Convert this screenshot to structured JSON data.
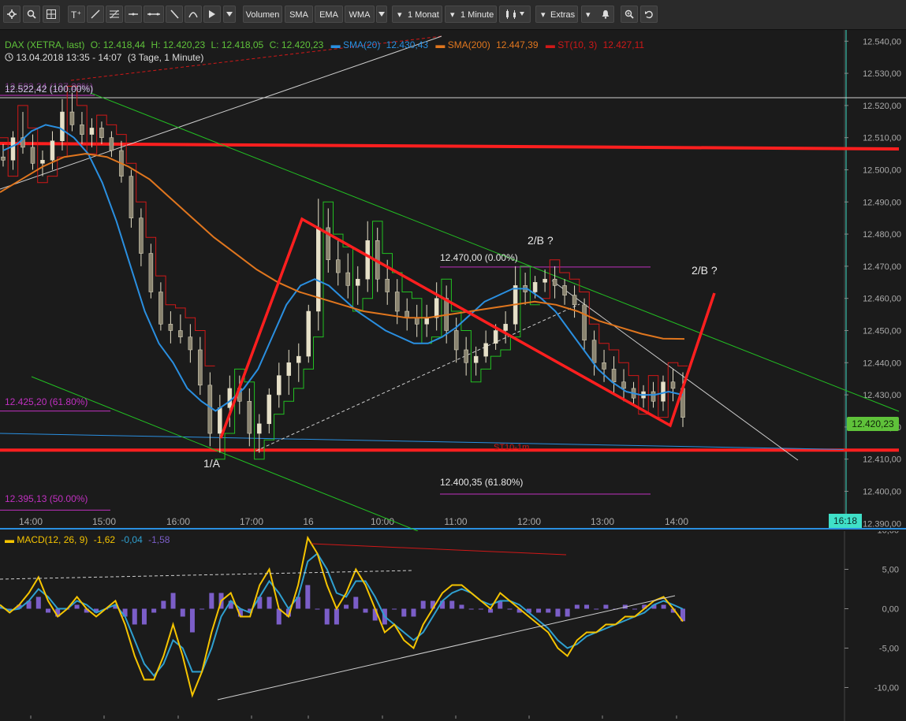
{
  "toolbar": {
    "buttons": [
      {
        "name": "settings-icon",
        "label": ""
      },
      {
        "name": "search-icon",
        "label": ""
      },
      {
        "name": "grid-icon",
        "label": ""
      },
      {
        "name": "text-tool-icon",
        "label": ""
      },
      {
        "name": "line-tool-icon",
        "label": ""
      },
      {
        "name": "fibonacci-tool-icon",
        "label": ""
      },
      {
        "name": "horizontal-line-icon",
        "label": ""
      },
      {
        "name": "channel-tool-icon",
        "label": ""
      },
      {
        "name": "pencil-icon",
        "label": ""
      },
      {
        "name": "curve-tool-icon",
        "label": ""
      },
      {
        "name": "cursor-icon",
        "label": ""
      },
      {
        "name": "dropdown-1",
        "label": ""
      },
      {
        "name": "volumen",
        "label": "Volumen"
      },
      {
        "name": "sma",
        "label": "SMA"
      },
      {
        "name": "ema",
        "label": "EMA"
      },
      {
        "name": "wma",
        "label": "WMA"
      },
      {
        "name": "period",
        "label": "1 Monat"
      },
      {
        "name": "interval",
        "label": "1 Minute"
      },
      {
        "name": "candles",
        "label": ""
      },
      {
        "name": "extras",
        "label": "Extras"
      },
      {
        "name": "alarm",
        "label": ""
      },
      {
        "name": "zoom",
        "label": ""
      },
      {
        "name": "reset",
        "label": ""
      }
    ]
  },
  "header": {
    "instrument": "DAX (XETRA, last)",
    "open": "O: 12.418,44",
    "high": "H: 12.420,23",
    "low": "L: 12.418,05",
    "close": "C: 12.420,23",
    "sma20_label": "SMA(20)",
    "sma20_value": "12.430,43",
    "sma200_label": "SMA(200)",
    "sma200_value": "12.447,39",
    "st_label": "ST(10, 3)",
    "st_value": "12.427,11",
    "date_range": "13.04.2018 13:35 - 14:07",
    "span": "(3 Tage, 1 Minute)"
  },
  "annotations": {
    "fib_100": "12.522,42 (100.00%)",
    "fib_127": "12.583,24 (127.20%)",
    "fib_618_left": "12.425,20 (61.80%)",
    "fib_50": "12.395,13 (50.00%)",
    "fib_0": "12.470,00 (0.00%)",
    "fib_618_right": "12.400,35 (61.80%)",
    "wave_1a": "1/A",
    "wave_2b_1": "2/B ?",
    "wave_2b_2": "2/B ?",
    "st_marker": "ST10-1m"
  },
  "price_axis": {
    "current_price": "12.420,23",
    "current_time": "16:18"
  },
  "macd_header": {
    "label": "MACD(12, 26, 9)",
    "v1": "-1,62",
    "v2": "-0,04",
    "v3": "-1,58"
  },
  "colors": {
    "background": "#1b1b1b",
    "candle": "#e6e0c8",
    "sma20": "#2a8fe0",
    "sma200": "#e0761e",
    "supertrend_red": "#d01818",
    "supertrend_green": "#22c022",
    "trend_red": "#ff1f1f",
    "fib_magenta": "#c030c0",
    "macd_yellow": "#f5c400",
    "macd_blue": "#2fa0d0",
    "macd_hist": "#7b5ec8",
    "price_tag": "#5fc23a"
  },
  "chart_data": [
    {
      "type": "candlestick",
      "title": "DAX (XETRA, last)",
      "interval": "1 Minute",
      "x_tick_labels": [
        "14:00",
        "15:00",
        "16:00",
        "17:00",
        "16",
        "10:00",
        "11:00",
        "12:00",
        "13:00",
        "14:00"
      ],
      "y_tick_labels": [
        "12.540,00",
        "12.530,00",
        "12.520,00",
        "12.510,00",
        "12.500,00",
        "12.490,00",
        "12.480,00",
        "12.470,00",
        "12.460,00",
        "12.450,00",
        "12.440,00",
        "12.430,00",
        "12.420,00",
        "12.410,00",
        "12.400,00",
        "12.390,00"
      ],
      "ylim": [
        12390,
        12543
      ],
      "grid": false,
      "horizontal_levels": [
        12522.42,
        12508.5,
        12413
      ],
      "series": [
        {
          "name": "DAX",
          "values": [
            [
              12504,
              12508,
              12501,
              12503
            ],
            [
              12503,
              12512,
              12500,
              12510
            ],
            [
              12510,
              12518,
              12505,
              12507
            ],
            [
              12507,
              12511,
              12500,
              12502
            ],
            [
              12502,
              12506,
              12498,
              12503
            ],
            [
              12503,
              12512,
              12500,
              12509
            ],
            [
              12509,
              12522,
              12506,
              12518
            ],
            [
              12518,
              12524,
              12512,
              12514
            ],
            [
              12514,
              12518,
              12508,
              12511
            ],
            [
              12511,
              12516,
              12507,
              12513
            ],
            [
              12513,
              12515,
              12508,
              12510
            ],
            [
              12510,
              12512,
              12504,
              12506
            ],
            [
              12506,
              12509,
              12496,
              12498
            ],
            [
              12498,
              12500,
              12482,
              12485
            ],
            [
              12485,
              12488,
              12470,
              12474
            ],
            [
              12474,
              12477,
              12460,
              12462
            ],
            [
              12462,
              12465,
              12450,
              12452
            ],
            [
              12452,
              12456,
              12446,
              12450
            ],
            [
              12450,
              12455,
              12446,
              12448
            ],
            [
              12448,
              12452,
              12440,
              12444
            ],
            [
              12444,
              12448,
              12430,
              12433
            ],
            [
              12433,
              12437,
              12414,
              12418
            ],
            [
              12418,
              12430,
              12412,
              12426
            ],
            [
              12426,
              12436,
              12420,
              12432
            ],
            [
              12432,
              12436,
              12424,
              12428
            ],
            [
              12428,
              12432,
              12414,
              12418
            ],
            [
              12418,
              12424,
              12412,
              12421
            ],
            [
              12421,
              12432,
              12418,
              12430
            ],
            [
              12430,
              12440,
              12426,
              12436
            ],
            [
              12436,
              12444,
              12430,
              12440
            ],
            [
              12440,
              12446,
              12434,
              12442
            ],
            [
              12442,
              12458,
              12440,
              12456
            ],
            [
              12456,
              12491,
              12450,
              12482
            ],
            [
              12482,
              12488,
              12468,
              12472
            ],
            [
              12472,
              12478,
              12464,
              12468
            ],
            [
              12468,
              12474,
              12460,
              12464
            ],
            [
              12464,
              12470,
              12458,
              12466
            ],
            [
              12466,
              12484,
              12462,
              12478
            ],
            [
              12478,
              12482,
              12462,
              12466
            ],
            [
              12466,
              12472,
              12458,
              12462
            ],
            [
              12462,
              12466,
              12452,
              12456
            ],
            [
              12456,
              12460,
              12450,
              12454
            ],
            [
              12454,
              12458,
              12448,
              12452
            ],
            [
              12452,
              12458,
              12448,
              12454
            ],
            [
              12454,
              12465,
              12450,
              12460
            ],
            [
              12460,
              12464,
              12446,
              12450
            ],
            [
              12450,
              12454,
              12440,
              12444
            ],
            [
              12444,
              12448,
              12436,
              12440
            ],
            [
              12440,
              12445,
              12436,
              12442
            ],
            [
              12442,
              12450,
              12440,
              12446
            ],
            [
              12446,
              12452,
              12444,
              12450
            ],
            [
              12450,
              12456,
              12446,
              12452
            ],
            [
              12452,
              12470,
              12450,
              12464
            ],
            [
              12464,
              12468,
              12458,
              12462
            ],
            [
              12462,
              12467,
              12460,
              12465
            ],
            [
              12465,
              12469,
              12462,
              12466
            ],
            [
              12466,
              12470,
              12460,
              12464
            ],
            [
              12464,
              12466,
              12458,
              12461
            ],
            [
              12461,
              12464,
              12454,
              12458
            ],
            [
              12458,
              12460,
              12444,
              12447
            ],
            [
              12447,
              12450,
              12436,
              12440
            ],
            [
              12440,
              12444,
              12434,
              12438
            ],
            [
              12438,
              12442,
              12430,
              12434
            ],
            [
              12434,
              12438,
              12428,
              12432
            ],
            [
              12432,
              12434,
              12427,
              12429
            ],
            [
              12429,
              12433,
              12426,
              12431
            ],
            [
              12431,
              12434,
              12426,
              12428
            ],
            [
              12428,
              12436,
              12425,
              12434
            ],
            [
              12434,
              12438,
              12428,
              12432
            ],
            [
              12432,
              12437,
              12420,
              12423
            ]
          ]
        },
        {
          "name": "SMA(20)",
          "values": [
            12506,
            12508,
            12512,
            12514,
            12513,
            12510,
            12505,
            12496,
            12484,
            12470,
            12456,
            12446,
            12440,
            12432,
            12428,
            12425,
            12428,
            12432,
            12438,
            12448,
            12458,
            12464,
            12466,
            12464,
            12460,
            12456,
            12453,
            12450,
            12448,
            12446,
            12446,
            12448,
            12451,
            12455,
            12459,
            12461,
            12463,
            12463,
            12460,
            12456,
            12450,
            12444,
            12438,
            12434,
            12431,
            12430,
            12430,
            12431,
            12430
          ]
        },
        {
          "name": "SMA(200)",
          "values": [
            12493,
            12497,
            12501,
            12504,
            12505,
            12504,
            12501,
            12497,
            12491,
            12485,
            12479,
            12474,
            12469,
            12465,
            12462,
            12460,
            12458,
            12456,
            12455,
            12454,
            12454,
            12455,
            12456,
            12457,
            12458,
            12459,
            12458,
            12456,
            12453,
            12451,
            12449,
            12447.5,
            12447.4
          ]
        },
        {
          "name": "ST(10, 3)",
          "values": [
            12427.11
          ]
        }
      ]
    },
    {
      "type": "line",
      "title": "MACD(12, 26, 9)",
      "y_tick_labels": [
        "10,00",
        "5,00",
        "0,00",
        "-5,00",
        "-10,00"
      ],
      "ylim": [
        -12,
        10
      ],
      "series": [
        {
          "name": "",
          "values": [
            0.5,
            -0.5,
            0.5,
            2,
            4,
            1,
            -1,
            0,
            1.5,
            0,
            -1,
            0,
            1,
            -2,
            -6,
            -9,
            -9,
            -6,
            -2,
            -6,
            -11,
            -8,
            -3,
            1,
            2,
            -1,
            -1,
            3,
            5,
            0,
            -1,
            3,
            9,
            7,
            3,
            0,
            2,
            5,
            3,
            0,
            -3,
            -2,
            -4,
            -5,
            -2,
            0,
            2,
            3,
            3,
            2,
            1,
            0,
            2,
            1,
            0,
            -1,
            -2,
            -3,
            -5,
            -6,
            -4,
            -3,
            -3,
            -2,
            -2,
            -1,
            -1,
            0,
            1,
            1.5,
            0,
            -1.62
          ]
        },
        {
          "name": "",
          "values": [
            0.2,
            -0.2,
            0,
            1,
            2.5,
            1.5,
            0,
            0,
            1,
            0.5,
            -0.5,
            0,
            0.5,
            -1,
            -4,
            -7,
            -8.5,
            -7,
            -4,
            -5,
            -8,
            -8,
            -5,
            -1,
            1,
            0,
            -0.5,
            1.5,
            3.5,
            2,
            0,
            1.5,
            6,
            7,
            5,
            2,
            1.5,
            3.5,
            3.5,
            1.5,
            -1,
            -2,
            -3,
            -4,
            -3,
            -1,
            1,
            2,
            2.5,
            2,
            1,
            0.5,
            1,
            1,
            0.5,
            -0.5,
            -1.5,
            -2.5,
            -4,
            -5,
            -4.5,
            -3.5,
            -3,
            -2.5,
            -2,
            -1.5,
            -1,
            -0.5,
            0.5,
            1,
            0.5,
            -0.04
          ]
        },
        {
          "name": "",
          "values": [
            0.3,
            -0.3,
            0.5,
            1,
            1.5,
            -0.5,
            -1,
            0,
            0.5,
            -0.5,
            -0.5,
            0,
            0.5,
            -1,
            -2,
            -2,
            -0.5,
            1,
            2,
            -1,
            -3,
            0,
            2,
            2,
            1,
            -1,
            -0.5,
            1.5,
            1.5,
            -2,
            -1,
            1.5,
            3,
            0,
            -2,
            -2,
            0.5,
            1.5,
            -0.5,
            -1.5,
            -2,
            0,
            -1,
            -1,
            1,
            1,
            1,
            1,
            0.5,
            0,
            0,
            -0.5,
            1,
            0,
            -0.5,
            -0.5,
            -0.5,
            -0.5,
            -1,
            -1,
            0.5,
            0.5,
            0,
            0.5,
            0,
            0.5,
            0,
            0.5,
            0.5,
            0.5,
            -0.5,
            -1.58
          ]
        }
      ]
    }
  ]
}
